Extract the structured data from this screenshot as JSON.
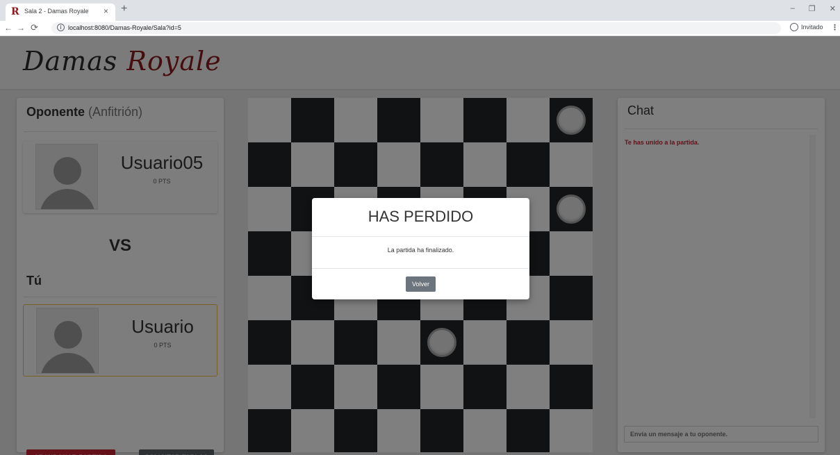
{
  "browser": {
    "tab_title": "Sala 2 - Damas Royale",
    "tab_favicon": "R",
    "tab_close": "×",
    "new_tab": "+",
    "url": "localhost:8080/Damas-Royale/Sala?id=5",
    "profile_label": "Invitado",
    "window_controls": [
      "–",
      "❐",
      "✕"
    ]
  },
  "header": {
    "logo_part1": "Damas ",
    "logo_part2": "Royale"
  },
  "opponent": {
    "heading": "Oponente",
    "role": "(Anfitrión)",
    "name": "Usuario05",
    "points": "0 PTS"
  },
  "vs_label": "VS",
  "me": {
    "heading": "Tú",
    "name": "Usuario",
    "points": "0 PTS"
  },
  "actions": {
    "abandon_label": "ABANDONAR PARTIDA",
    "draw_label": "SOLICITAR TABLAS"
  },
  "board": {
    "rows": 8,
    "cols": 8,
    "pieces": [
      {
        "row": 0,
        "col": 7,
        "color": "light"
      },
      {
        "row": 2,
        "col": 7,
        "color": "light"
      },
      {
        "row": 5,
        "col": 4,
        "color": "light"
      }
    ]
  },
  "chat": {
    "title": "Chat",
    "messages": [
      "Te has unido a la partida."
    ],
    "input_placeholder": "Envía un mensaje a tu oponente."
  },
  "modal": {
    "title": "HAS PERDIDO",
    "body": "La partida ha finalizado.",
    "button_label": "Volver"
  },
  "colors": {
    "brand_red": "#8b1a1a",
    "danger": "#c82333",
    "secondary": "#5a6268",
    "dark_square": "#212529"
  }
}
